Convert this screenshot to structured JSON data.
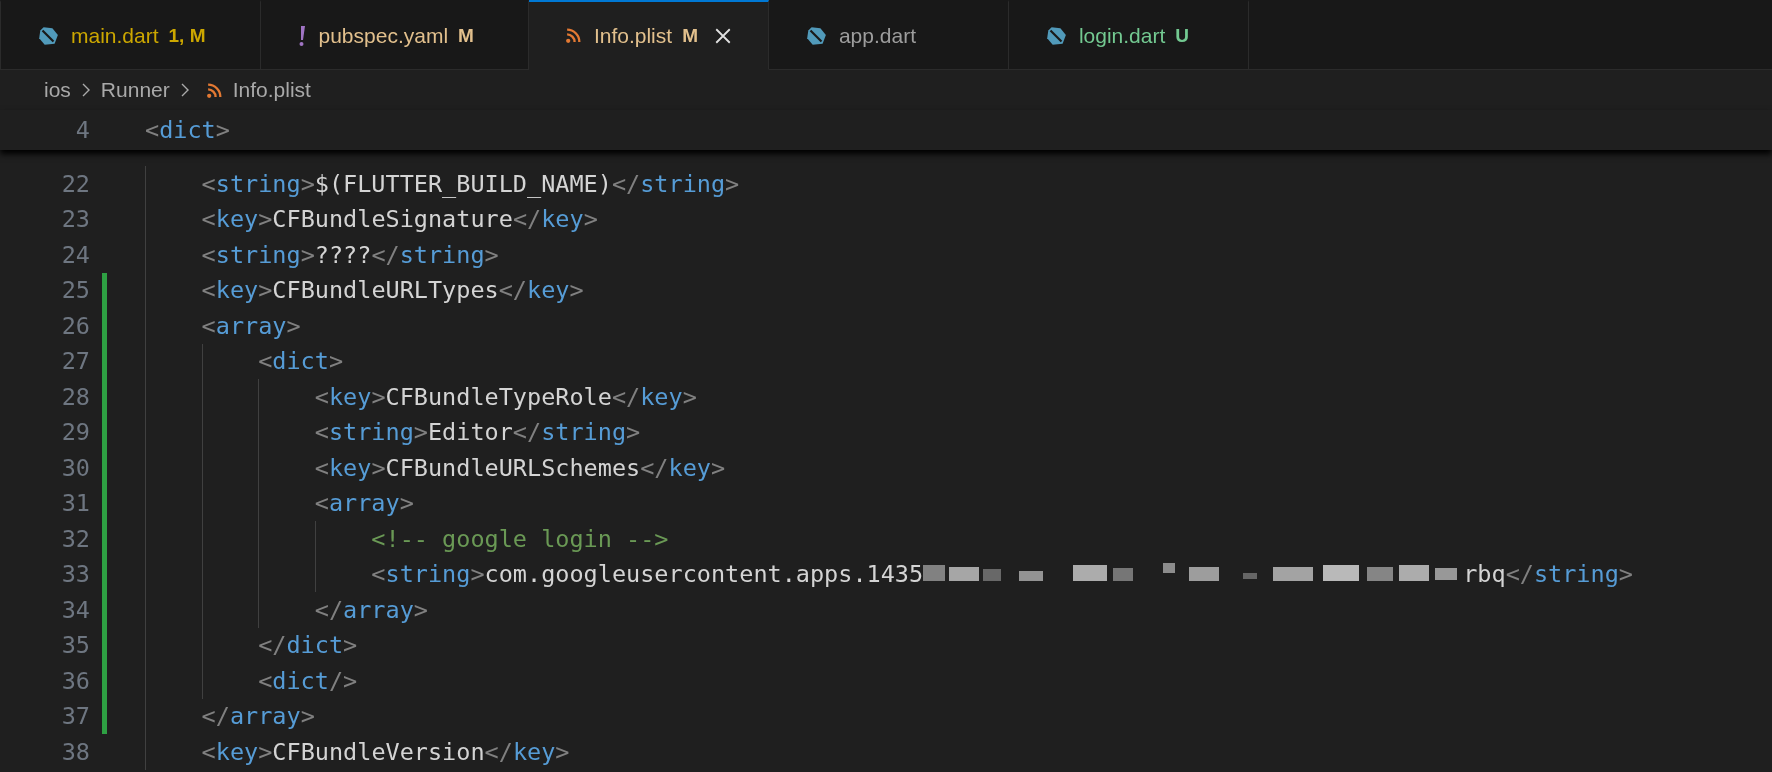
{
  "tabs": [
    {
      "label": "main.dart",
      "kind": "dart",
      "badge": "1, M",
      "color": "#cca700",
      "selected": false
    },
    {
      "label": "pubspec.yaml",
      "kind": "yaml",
      "badge": "M",
      "color": "#e2c08d",
      "selected": false
    },
    {
      "label": "Info.plist",
      "kind": "plist",
      "badge": "M",
      "color": "#e2c08d",
      "selected": true
    },
    {
      "label": "app.dart",
      "kind": "dart",
      "selected": false
    },
    {
      "label": "login.dart",
      "kind": "dart",
      "badge": "U",
      "color": "#73c991",
      "selected": false
    }
  ],
  "breadcrumb": [
    {
      "label": "ios",
      "kind": "folder"
    },
    {
      "label": "Runner",
      "kind": "folder"
    },
    {
      "label": "Info.plist",
      "kind": "plist"
    }
  ],
  "sticky_line": {
    "number": "4",
    "segments": [
      {
        "kind": "code",
        "tokens": [
          {
            "kind": "punct",
            "text": "<"
          },
          {
            "kind": "tag",
            "text": "dict"
          },
          {
            "kind": "punct",
            "text": ">"
          }
        ]
      }
    ]
  },
  "lines": [
    {
      "number": "22",
      "changed": false,
      "segments": [
        {
          "kind": "code",
          "tokens": [
            {
              "kind": "punct",
              "text": "<"
            },
            {
              "kind": "tag",
              "text": "string"
            },
            {
              "kind": "punct",
              "text": ">"
            },
            {
              "kind": "text",
              "text": "$(FLUTTER_BUILD_NAME)"
            },
            {
              "kind": "punct",
              "text": "</"
            },
            {
              "kind": "tag",
              "text": "string"
            },
            {
              "kind": "punct",
              "text": ">"
            }
          ]
        }
      ]
    },
    {
      "number": "23",
      "changed": false,
      "segments": [
        {
          "kind": "code",
          "tokens": [
            {
              "kind": "punct",
              "text": "<"
            },
            {
              "kind": "tag",
              "text": "key"
            },
            {
              "kind": "punct",
              "text": ">"
            },
            {
              "kind": "text",
              "text": "CFBundleSignature"
            },
            {
              "kind": "punct",
              "text": "</"
            },
            {
              "kind": "tag",
              "text": "key"
            },
            {
              "kind": "punct",
              "text": ">"
            }
          ]
        }
      ]
    },
    {
      "number": "24",
      "changed": false,
      "segments": [
        {
          "kind": "code",
          "tokens": [
            {
              "kind": "punct",
              "text": "<"
            },
            {
              "kind": "tag",
              "text": "string"
            },
            {
              "kind": "punct",
              "text": ">"
            },
            {
              "kind": "text",
              "text": "????"
            },
            {
              "kind": "punct",
              "text": "</"
            },
            {
              "kind": "tag",
              "text": "string"
            },
            {
              "kind": "punct",
              "text": ">"
            }
          ]
        }
      ]
    },
    {
      "number": "25",
      "changed": true,
      "segments": [
        {
          "kind": "code",
          "tokens": [
            {
              "kind": "punct",
              "text": "<"
            },
            {
              "kind": "tag",
              "text": "key"
            },
            {
              "kind": "punct",
              "text": ">"
            },
            {
              "kind": "text",
              "text": "CFBundleURLTypes"
            },
            {
              "kind": "punct",
              "text": "</"
            },
            {
              "kind": "tag",
              "text": "key"
            },
            {
              "kind": "punct",
              "text": ">"
            }
          ]
        }
      ]
    },
    {
      "number": "26",
      "changed": true,
      "segments": [
        {
          "kind": "code",
          "tokens": [
            {
              "kind": "punct",
              "text": "<"
            },
            {
              "kind": "tag",
              "text": "array"
            },
            {
              "kind": "punct",
              "text": ">"
            }
          ]
        }
      ],
      "children": [
        {
          "number": "27",
          "changed": true,
          "segments": [
            {
              "kind": "code",
              "tokens": [
                {
                  "kind": "punct",
                  "text": "<"
                },
                {
                  "kind": "tag",
                  "text": "dict"
                },
                {
                  "kind": "punct",
                  "text": ">"
                }
              ]
            }
          ],
          "children": [
            {
              "number": "28",
              "changed": true,
              "segments": [
                {
                  "kind": "code",
                  "tokens": [
                    {
                      "kind": "punct",
                      "text": "<"
                    },
                    {
                      "kind": "tag",
                      "text": "key"
                    },
                    {
                      "kind": "punct",
                      "text": ">"
                    },
                    {
                      "kind": "text",
                      "text": "CFBundleTypeRole"
                    },
                    {
                      "kind": "punct",
                      "text": "</"
                    },
                    {
                      "kind": "tag",
                      "text": "key"
                    },
                    {
                      "kind": "punct",
                      "text": ">"
                    }
                  ]
                }
              ]
            },
            {
              "number": "29",
              "changed": true,
              "segments": [
                {
                  "kind": "code",
                  "tokens": [
                    {
                      "kind": "punct",
                      "text": "<"
                    },
                    {
                      "kind": "tag",
                      "text": "string"
                    },
                    {
                      "kind": "punct",
                      "text": ">"
                    },
                    {
                      "kind": "text",
                      "text": "Editor"
                    },
                    {
                      "kind": "punct",
                      "text": "</"
                    },
                    {
                      "kind": "tag",
                      "text": "string"
                    },
                    {
                      "kind": "punct",
                      "text": ">"
                    }
                  ]
                }
              ]
            },
            {
              "number": "30",
              "changed": true,
              "segments": [
                {
                  "kind": "code",
                  "tokens": [
                    {
                      "kind": "punct",
                      "text": "<"
                    },
                    {
                      "kind": "tag",
                      "text": "key"
                    },
                    {
                      "kind": "punct",
                      "text": ">"
                    },
                    {
                      "kind": "text",
                      "text": "CFBundleURLSchemes"
                    },
                    {
                      "kind": "punct",
                      "text": "</"
                    },
                    {
                      "kind": "tag",
                      "text": "key"
                    },
                    {
                      "kind": "punct",
                      "text": ">"
                    }
                  ]
                }
              ]
            },
            {
              "number": "31",
              "changed": true,
              "segments": [
                {
                  "kind": "code",
                  "tokens": [
                    {
                      "kind": "punct",
                      "text": "<"
                    },
                    {
                      "kind": "tag",
                      "text": "array"
                    },
                    {
                      "kind": "punct",
                      "text": ">"
                    }
                  ]
                }
              ],
              "children": [
                {
                  "number": "32",
                  "changed": true,
                  "segments": [
                    {
                      "kind": "code",
                      "tokens": [
                        {
                          "kind": "comment",
                          "text": "<!-- google login -->"
                        }
                      ]
                    }
                  ]
                },
                {
                  "number": "33",
                  "changed": true,
                  "segments": [
                    {
                      "kind": "code",
                      "tokens": [
                        {
                          "kind": "punct",
                          "text": "<"
                        },
                        {
                          "kind": "tag",
                          "text": "string"
                        },
                        {
                          "kind": "punct",
                          "text": ">"
                        },
                        {
                          "kind": "text",
                          "text": "com.googleusercontent.apps.1435"
                        }
                      ]
                    },
                    {
                      "kind": "redacted"
                    },
                    {
                      "kind": "code",
                      "tokens": [
                        {
                          "kind": "text",
                          "text": "rbq"
                        },
                        {
                          "kind": "punct",
                          "text": "</"
                        },
                        {
                          "kind": "tag",
                          "text": "string"
                        },
                        {
                          "kind": "punct",
                          "text": ">"
                        }
                      ]
                    }
                  ]
                }
              ]
            },
            {
              "number": "34",
              "changed": true,
              "segments": [
                {
                  "kind": "code",
                  "tokens": [
                    {
                      "kind": "punct",
                      "text": "</"
                    },
                    {
                      "kind": "tag",
                      "text": "array"
                    },
                    {
                      "kind": "punct",
                      "text": ">"
                    }
                  ]
                }
              ]
            }
          ]
        },
        {
          "number": "35",
          "changed": true,
          "segments": [
            {
              "kind": "code",
              "tokens": [
                {
                  "kind": "punct",
                  "text": "</"
                },
                {
                  "kind": "tag",
                  "text": "dict"
                },
                {
                  "kind": "punct",
                  "text": ">"
                }
              ]
            }
          ]
        },
        {
          "number": "36",
          "changed": true,
          "segments": [
            {
              "kind": "code",
              "tokens": [
                {
                  "kind": "punct",
                  "text": "<"
                },
                {
                  "kind": "tag",
                  "text": "dict"
                },
                {
                  "kind": "punct",
                  "text": "/>"
                }
              ]
            }
          ]
        }
      ]
    },
    {
      "number": "37",
      "changed": true,
      "segments": [
        {
          "kind": "code",
          "tokens": [
            {
              "kind": "punct",
              "text": "</"
            },
            {
              "kind": "tag",
              "text": "array"
            },
            {
              "kind": "punct",
              "text": ">"
            }
          ]
        }
      ]
    },
    {
      "number": "38",
      "changed": false,
      "segments": [
        {
          "kind": "code",
          "tokens": [
            {
              "kind": "punct",
              "text": "<"
            },
            {
              "kind": "tag",
              "text": "key"
            },
            {
              "kind": "punct",
              "text": ">"
            },
            {
              "kind": "text",
              "text": "CFBundleVersion"
            },
            {
              "kind": "punct",
              "text": "</"
            },
            {
              "kind": "tag",
              "text": "key"
            },
            {
              "kind": "punct",
              "text": ">"
            }
          ]
        }
      ]
    }
  ]
}
